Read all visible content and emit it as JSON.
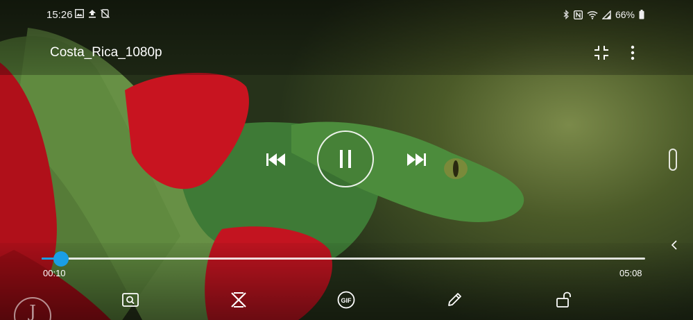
{
  "status_bar": {
    "time": "15:26",
    "left_icons": [
      "gallery-icon",
      "upload-icon",
      "notifications-off-icon"
    ],
    "right_icons": [
      "bluetooth-icon",
      "nfc-icon",
      "wifi-icon",
      "cellular-signal-icon",
      "battery-icon"
    ],
    "battery_percent": "66%"
  },
  "title_bar": {
    "title": "Costa_Rica_1080p",
    "actions": [
      "exit-fullscreen-icon",
      "more-options-icon"
    ]
  },
  "playback": {
    "state": "playing",
    "controls": [
      "previous-icon",
      "pause-icon",
      "next-icon"
    ]
  },
  "seek": {
    "current_time": "00:10",
    "total_time": "05:08",
    "progress_fraction": 0.0325
  },
  "bottom_toolbar": {
    "tools": [
      "capture-icon",
      "video-editor-icon",
      "gif-icon",
      "edit-icon",
      "unlock-icon"
    ]
  },
  "watermark": {
    "letter": "J"
  },
  "colors": {
    "accent": "#1a9ee6",
    "text": "#ffffff"
  }
}
